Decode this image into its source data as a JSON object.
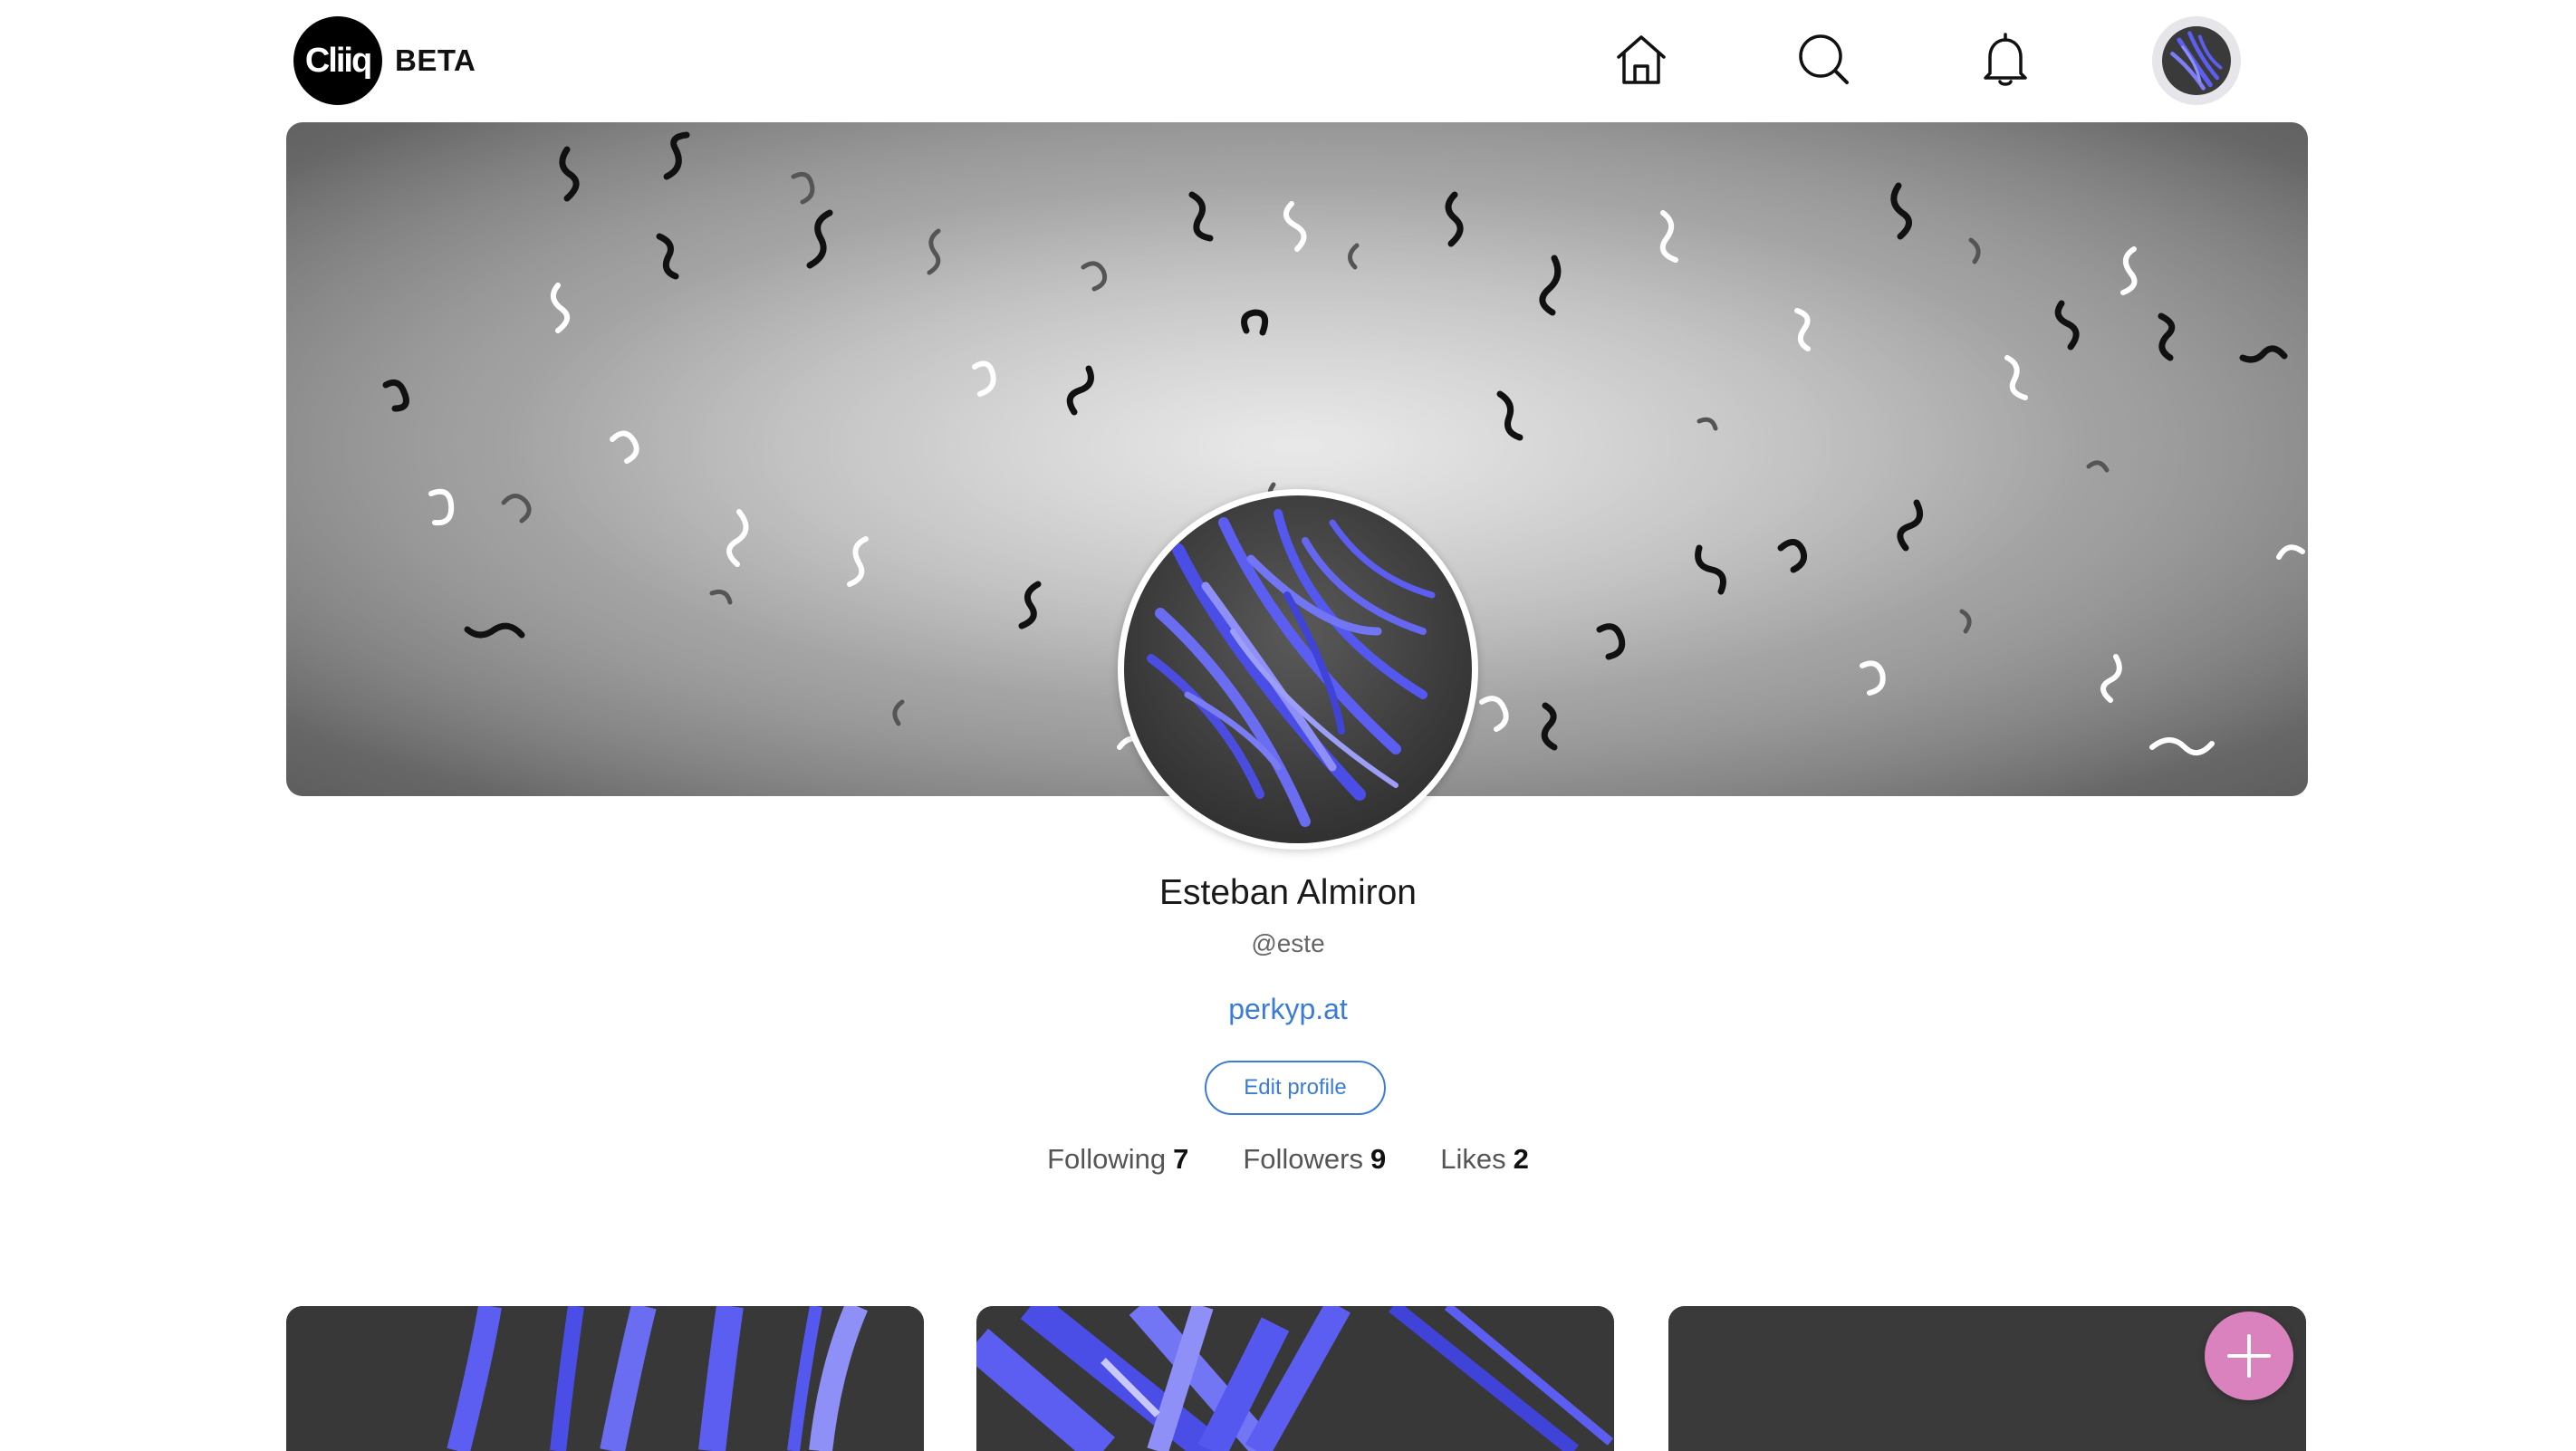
{
  "header": {
    "logo_text": "Cliiq",
    "badge": "BETA",
    "nav": [
      {
        "icon": "home-icon"
      },
      {
        "icon": "search-icon"
      },
      {
        "icon": "bell-icon"
      },
      {
        "icon": "user-avatar"
      }
    ]
  },
  "profile": {
    "name": "Esteban Almiron",
    "handle": "@este",
    "website": "perkyp.at",
    "edit_label": "Edit profile",
    "stats": [
      {
        "label": "Following",
        "value": "7"
      },
      {
        "label": "Followers",
        "value": "9"
      },
      {
        "label": "Likes",
        "value": "2"
      }
    ]
  },
  "fab": {
    "icon": "plus-icon"
  },
  "colors": {
    "accent": "#3b7cd6",
    "fab": "#d982bd",
    "art_blue": "#5b5ef0",
    "card_bg": "#3b3b3b"
  }
}
